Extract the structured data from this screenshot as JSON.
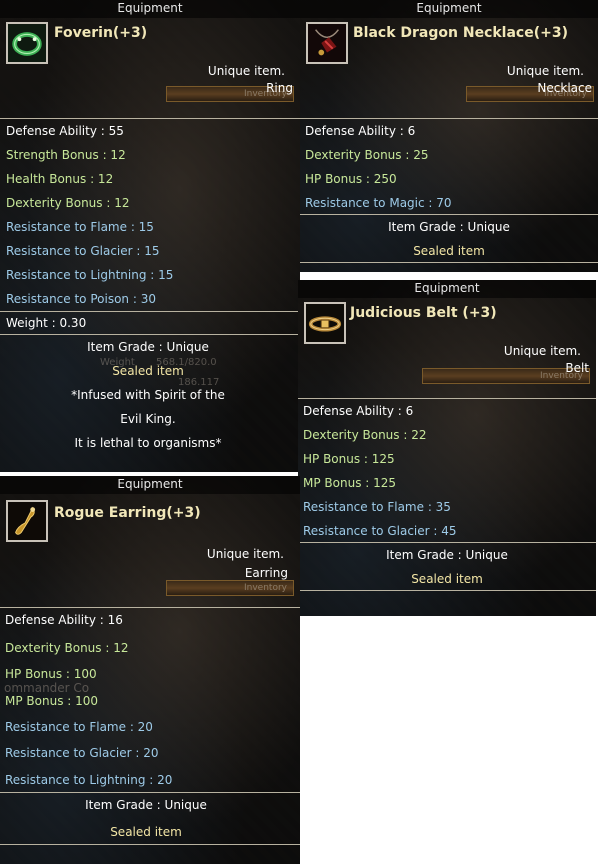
{
  "panels": {
    "foverin": {
      "header": "Equipment",
      "name": "Foverin(+3)",
      "unique": "Unique item.",
      "slot": "Ring",
      "inventory": "Inventory",
      "defense": "Defense Ability : 55",
      "bonuses": [
        {
          "text": "Strength Bonus : 12",
          "color": "green"
        },
        {
          "text": "Health Bonus : 12",
          "color": "green"
        },
        {
          "text": "Dexterity Bonus : 12",
          "color": "green"
        },
        {
          "text": "Resistance to Flame : 15",
          "color": "blue"
        },
        {
          "text": "Resistance to Glacier : 15",
          "color": "blue"
        },
        {
          "text": "Resistance to Lightning : 15",
          "color": "blue"
        },
        {
          "text": "Resistance to Poison : 30",
          "color": "blue"
        }
      ],
      "weight": "Weight : 0.30",
      "grade": "Item Grade : Unique",
      "sealed": "Sealed item",
      "desc1": "*Infused with Spirit of the",
      "desc2": "Evil King.",
      "desc3": "It is lethal to organisms*",
      "bg_weight": "Weight",
      "bg_weight_val": "568.1/820.0",
      "bg_coord": "186.117",
      "icon": "ring-icon"
    },
    "necklace": {
      "header": "Equipment",
      "name": "Black Dragon Necklace(+3)",
      "unique": "Unique item.",
      "slot": "Necklace",
      "inventory": "Inventory",
      "defense": "Defense Ability : 6",
      "bonuses": [
        {
          "text": "Dexterity Bonus : 25",
          "color": "green"
        },
        {
          "text": "HP Bonus : 250",
          "color": "green"
        },
        {
          "text": "Resistance to Magic : 70",
          "color": "blue"
        }
      ],
      "grade": "Item Grade : Unique",
      "sealed": "Sealed item",
      "icon": "necklace-icon"
    },
    "belt": {
      "header": "Equipment",
      "name": "Judicious Belt (+3)",
      "unique": "Unique item.",
      "slot": "Belt",
      "inventory": "Inventory",
      "defense": "Defense Ability : 6",
      "bonuses": [
        {
          "text": "Dexterity Bonus : 22",
          "color": "green"
        },
        {
          "text": "HP Bonus : 125",
          "color": "green"
        },
        {
          "text": "MP Bonus : 125",
          "color": "green"
        },
        {
          "text": "Resistance to Flame : 35",
          "color": "blue"
        },
        {
          "text": "Resistance to Glacier : 45",
          "color": "blue"
        }
      ],
      "grade": "Item Grade : Unique",
      "sealed": "Sealed item",
      "icon": "belt-icon"
    },
    "earring": {
      "header": "Equipment",
      "name": "Rogue Earring(+3)",
      "unique": "Unique item.",
      "slot": "Earring",
      "inventory": "Inventory",
      "defense": "Defense Ability : 16",
      "bonuses": [
        {
          "text": "Dexterity Bonus : 12",
          "color": "green"
        },
        {
          "text": "HP Bonus : 100",
          "color": "green"
        },
        {
          "text": "MP Bonus : 100",
          "color": "green"
        },
        {
          "text": "Resistance to Flame : 20",
          "color": "blue"
        },
        {
          "text": "Resistance to Glacier : 20",
          "color": "blue"
        },
        {
          "text": "Resistance to Lightning : 20",
          "color": "blue"
        }
      ],
      "grade": "Item Grade : Unique",
      "sealed": "Sealed item",
      "bg_text": "ommander Co",
      "icon": "earring-icon"
    }
  },
  "colors": {
    "green": "#c8e89a",
    "blue": "#9ecbe8",
    "gold": "#f3e6a6",
    "name": "#f1e7b8"
  }
}
